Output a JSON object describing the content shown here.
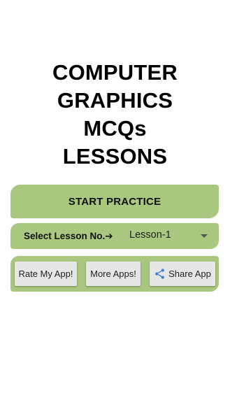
{
  "title_lines": [
    "COMPUTER",
    "GRAPHICS",
    "MCQs",
    "LESSONS"
  ],
  "start_button": {
    "label": "START PRACTICE"
  },
  "lesson_select": {
    "label": "Select Lesson No.➔",
    "selected": "Lesson-1"
  },
  "buttons": {
    "rate": "Rate My App!",
    "more": "More Apps!",
    "share": "Share App"
  },
  "icons": {
    "share": "share-icon",
    "dropdown": "dropdown-arrow-icon"
  },
  "colors": {
    "panel": "#a9c77f",
    "button": "#e6e6e6",
    "share_icon": "#3f7fd0"
  }
}
